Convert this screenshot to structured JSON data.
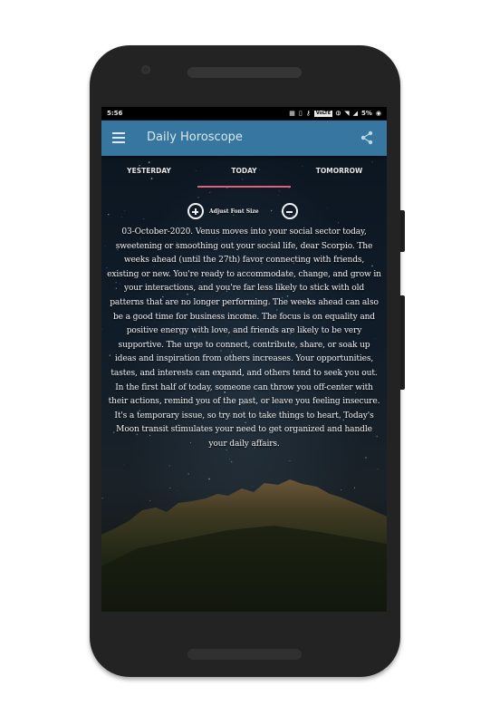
{
  "status_bar": {
    "time": "5:56",
    "icons": [
      "sim-icon",
      "phone-icon",
      "key-icon",
      "volte-icon",
      "vibrate-icon",
      "wifi-icon",
      "signal-icon",
      "battery-percent",
      "battery-icon"
    ],
    "volte_label": "VoLTE",
    "battery": "5%"
  },
  "app_bar": {
    "title": "Daily Horoscope",
    "menu_icon": "hamburger-menu-icon",
    "share_icon": "share-icon"
  },
  "tabs": [
    {
      "label": "YESTERDAY",
      "active": false
    },
    {
      "label": "TODAY",
      "active": true
    },
    {
      "label": "TOMORROW",
      "active": false
    }
  ],
  "accent_colors": {
    "app_bar": "#37779f",
    "tab_indicator": "#e0607a"
  },
  "font_controls": {
    "label": "Adjust Font Size",
    "increase_icon": "plus-circle-icon",
    "decrease_icon": "minus-circle-icon"
  },
  "horoscope": {
    "date": "03-October-2020.",
    "sign": "Scorpio",
    "text": "03-October-2020. Venus moves into your social sector today, sweetening or smoothing out your social life, dear Scorpio. The weeks ahead (until the 27th) favor connecting with friends, existing or new. You're ready to accommodate, change, and grow in your interactions, and you're far less likely to stick with old patterns that are no longer performing. The weeks ahead can also be a good time for business income. The focus is on equality and positive energy with love, and friends are likely to be very supportive. The urge to connect, contribute, share, or soak up ideas and inspiration from others increases. Your opportunities, tastes, and interests can expand, and others tend to seek you out. In the first half of today, someone can throw you off-center with their actions, remind you of the past, or leave you feeling insecure. It's a temporary issue, so try not to take things to heart. Today's Moon transit stimulates your need to get organized and handle your daily affairs."
  }
}
